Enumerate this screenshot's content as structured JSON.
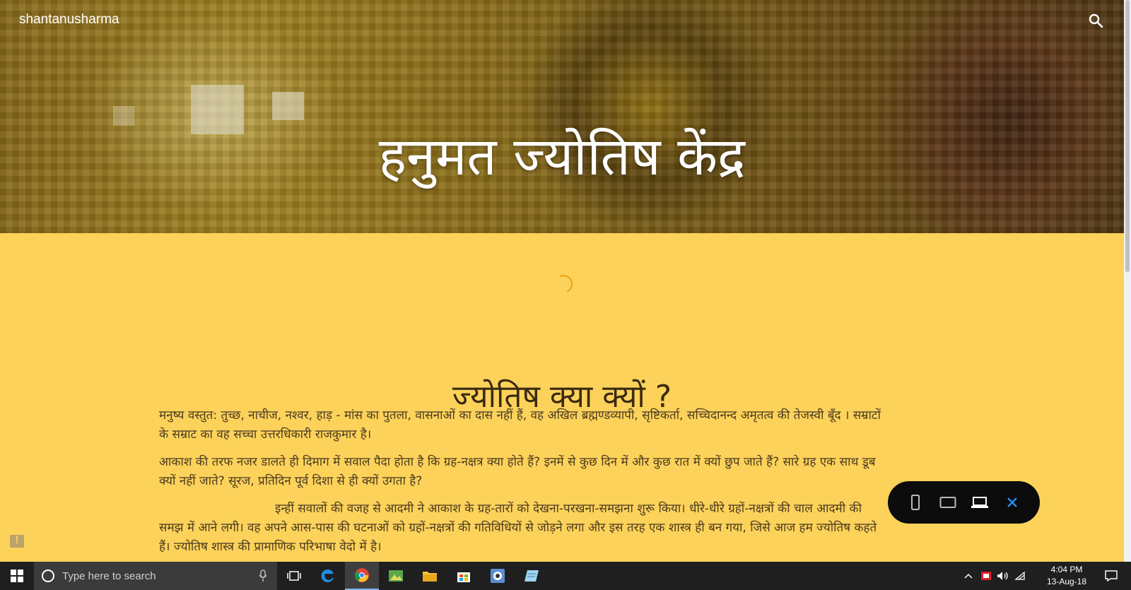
{
  "site": {
    "name": "shantanusharma",
    "hero_title": "हनुमत ज्योतिष केंद्र"
  },
  "article": {
    "title": "ज्योतिष क्या क्यों ?",
    "paragraphs": [
      "मनुष्य वस्तुत: तुच्छ, नाचीज, नश्वर, हाड़ - मांस का पुतला, वासनाओं का दास नहीं हैं, वह अखिल  ब्रह्मण्डव्यापी, सृष्टिकर्ता, सच्चिदानन्द अमृतत्व की तेजस्वी बूँद । सम्राटों के सम्राट का वह सच्चा उत्तरधिकारी राजकुमार है।",
      "आकाश की तरफ नजर डालते ही दिमाग में सवाल पैदा होता है कि ग्रह-नक्षत्र क्या होते हैं? इनमें से कुछ दिन में और कुछ रात में क्यों छुप जाते हैं? सारे ग्रह एक साथ डूब क्यों नहीं जाते? सूरज, प्रतिदिन पूर्व दिशा से ही क्यों उगता है?",
      "इन्हीं सवालों की वजह से आदमी ने आकाश के ग्रह-तारों को देखना-परखना-समझना शुरू किया। धीरे-धीरे ग्रहों-नक्षत्रों की चाल आदमी की समझ में आने लगी। वह अपने आस-पास की घटनाओं को ग्रहों-नक्षत्रों की गतिविधियों से जोड़ने लगा और इस तरह एक शास्त्र ही बन गया, जिसे आज हम ज्योतिष कहते हैं। ज्योतिष शास्त्र की प्रामाणिक परिभाषा वेदो में है।"
    ]
  },
  "taskbar": {
    "search_placeholder": "Type here to search",
    "time": "4:04 PM",
    "date": "13-Aug-18"
  },
  "colors": {
    "page_background": "#fdd25a",
    "spinner": "#e8a51a",
    "viewer_bar": "#0c0c0c",
    "close_accent": "#2b8cf0"
  }
}
